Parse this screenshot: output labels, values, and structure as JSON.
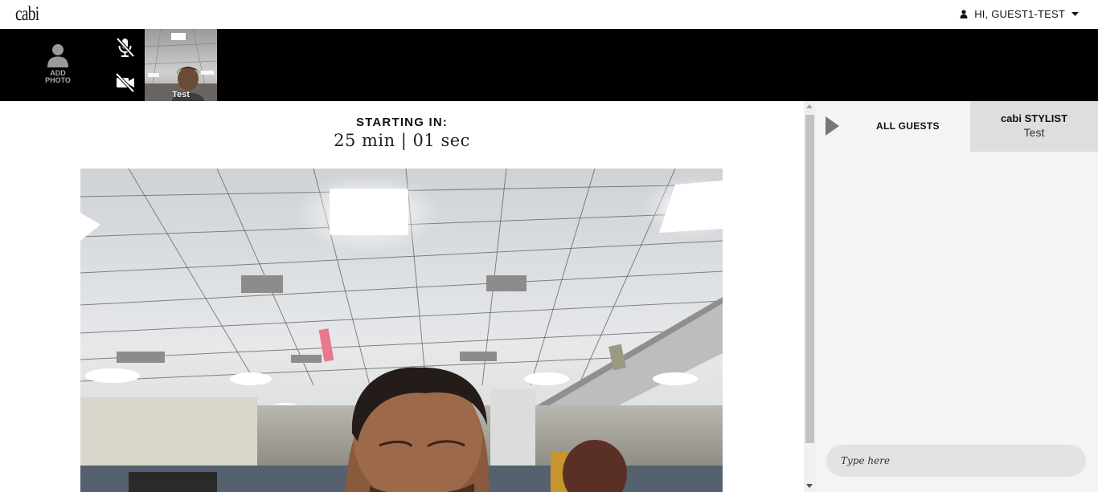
{
  "app": {
    "logo": "cabi"
  },
  "header": {
    "greeting": "HI, GUEST1-TEST"
  },
  "strip": {
    "add_photo_line1": "ADD",
    "add_photo_line2": "PHOTO",
    "participant_name": "Test"
  },
  "main": {
    "starting_label": "STARTING IN:",
    "countdown": "25 min | 01 sec"
  },
  "panel": {
    "tab_all_guests": "ALL GUESTS",
    "tab_stylist_title": "cabi STYLIST",
    "tab_stylist_name": "Test",
    "chat_placeholder": "Type here"
  },
  "icons": {
    "user": "user-icon",
    "caret": "caret-down-icon",
    "avatar": "person-silhouette-icon",
    "mic": "mic-off-icon",
    "camera": "video-off-icon",
    "play": "play-triangle-icon"
  },
  "colors": {
    "strip_bg": "#000000",
    "panel_bg": "#f4f4f4",
    "stylist_tab_bg": "#dedede",
    "input_bg": "#e3e3e3"
  }
}
